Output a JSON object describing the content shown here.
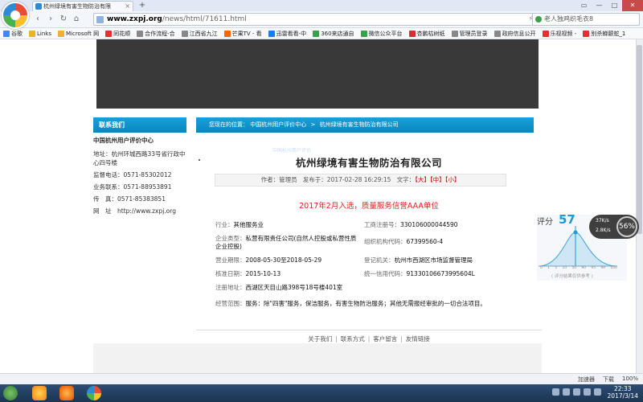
{
  "browser": {
    "tab_title": "杭州绿境有害生物防治有限",
    "tab_close": "×",
    "new_tab": "+",
    "window_controls": [
      "▭",
      "—",
      "□",
      "✕"
    ],
    "nav": {
      "back": "‹",
      "forward": "›",
      "refresh": "↻",
      "home": "⌂",
      "star": "☆"
    },
    "url_host": "www.zxpj.org",
    "url_path": "/news/html/71611.html",
    "addr_tools": "⚡ ◂",
    "search_placeholder": "老人独鸡织毛衣8",
    "bookmarks": [
      {
        "label": "谷歌",
        "color": "#4285f4"
      },
      {
        "label": "Links",
        "color": "#e8b32e"
      },
      {
        "label": "Microsoft 网",
        "color": "#e8b32e"
      },
      {
        "label": "同花顺",
        "color": "#d33"
      },
      {
        "label": "合作流程-合",
        "color": "#888"
      },
      {
        "label": "江西省九江",
        "color": "#888"
      },
      {
        "label": "芒果TV - 看",
        "color": "#f60"
      },
      {
        "label": "迅雷看看-中",
        "color": "#1b7de0"
      },
      {
        "label": "360来店通自",
        "color": "#3aa14a"
      },
      {
        "label": "微信公众平台",
        "color": "#3aa14a"
      },
      {
        "label": "杏鹏枯树纸",
        "color": "#c33"
      },
      {
        "label": "管理员登录",
        "color": "#888"
      },
      {
        "label": "政府信息公开",
        "color": "#888"
      },
      {
        "label": "乐视视频 -",
        "color": "#d33"
      },
      {
        "label": "别杀蝉颤蛇_1",
        "color": "#d33"
      }
    ]
  },
  "sidebar": {
    "title": "联系我们",
    "org": "中国杭州用户评价中心",
    "address": "地址：杭州环城西路33号省行政中心四号楼",
    "supervise": "监督电话：0571-85302012",
    "business": "业务联系：0571-88953891",
    "fax": "传　真：0571-85383851",
    "website": "网　址　http://www.zxpj.org"
  },
  "breadcrumb": {
    "prefix": "您现在的位置：",
    "level1": "中国杭州用户评价中心",
    "separator": ">",
    "level2": "杭州绿境有害生物防治有限公司"
  },
  "article": {
    "watermark": "中国杭州用户评价",
    "title": "杭州绿境有害生物防治有限公司",
    "author_label": "作者：",
    "author": "管理员",
    "published_label": "发布于：",
    "published": "2017-02-28 16:29:15",
    "font_label": "文字：",
    "font_large": "【大】",
    "font_medium": "【中】",
    "font_small": "【小】",
    "honor": "2017年2月入选，质量服务信誉AAA单位"
  },
  "fields": {
    "industry_label": "行业：",
    "industry": "其他服务业",
    "regno_label": "工商注册号：",
    "regno": "330106000044590",
    "type_label": "企业类型：",
    "type": "私营有限责任公司(自然人控股或私营性质企业控股)",
    "orgcode_label": "组织机构代码：",
    "orgcode": "67399560-4",
    "term_label": "营业期限：",
    "term": "2008-05-30至2018-05-29",
    "authority_label": "登记机关：",
    "authority": "杭州市西湖区市场监督管理局",
    "approved_label": "核准日期：",
    "approved": "2015-10-13",
    "credit_label": "统一信用代码：",
    "credit": "91330106673995604L",
    "address_label": "注册地址：",
    "address": "西湖区天目山路398号18号楼401室",
    "scope_label": "经营范围：",
    "scope": "服务：除\"四害\"服务，保洁服务，有害生物防治服务；其他无需报经审批的一切合法项目。"
  },
  "footer_links": [
    "关于我们",
    "联系方式",
    "客户留言",
    "友情链接"
  ],
  "footer_sep": "|",
  "rating": {
    "label": "评分",
    "score": "57",
    "ticks": [
      "0",
      "1",
      "5",
      "10",
      "50",
      "90",
      "95",
      "99",
      "100"
    ],
    "caption": "( 评分结果仅供参考 )"
  },
  "speed": {
    "up": "37K/s",
    "down": "2.8K/s",
    "percent": "56%"
  },
  "statusbar": {
    "accelerator": "加速器",
    "download": "下载",
    "zoom": "100%"
  },
  "clock": {
    "time": "22:33",
    "date": "2017/3/14"
  },
  "colors": {
    "accent": "#1ba0d5",
    "honor_red": "#d22",
    "score_blue": "#1a9ad6"
  }
}
